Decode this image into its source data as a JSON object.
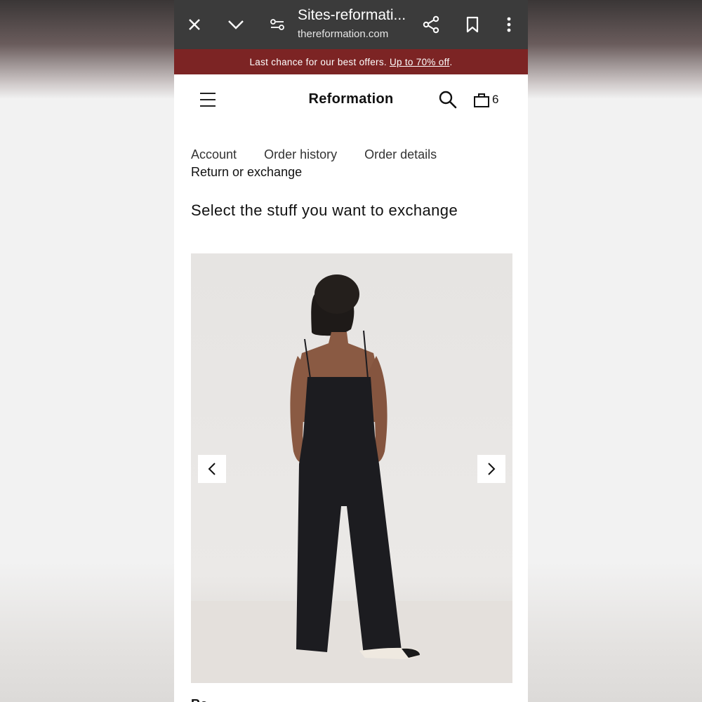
{
  "browser": {
    "tab_title": "Sites-reformati...",
    "domain": "thereformation.com",
    "close_icon": "close-icon",
    "collapse_icon": "chevron-down-icon",
    "site_settings_icon": "tune-icon",
    "share_icon": "share-icon",
    "bookmark_icon": "bookmark-icon",
    "menu_icon": "more-vert-icon"
  },
  "promo": {
    "text": "Last chance for our best offers.",
    "link": "Up to 70% off",
    "suffix": ".",
    "background": "#7c2424"
  },
  "header": {
    "brand": "Reformation",
    "bag_count": "6"
  },
  "breadcrumb": {
    "items": [
      "Account",
      "Order history",
      "Order details"
    ],
    "current": "Return or exchange"
  },
  "main": {
    "title": "Select the stuff you want to exchange"
  },
  "product": {
    "prev_icon": "chevron-left-icon",
    "next_icon": "chevron-right-icon",
    "name_partial": "Ro..."
  }
}
